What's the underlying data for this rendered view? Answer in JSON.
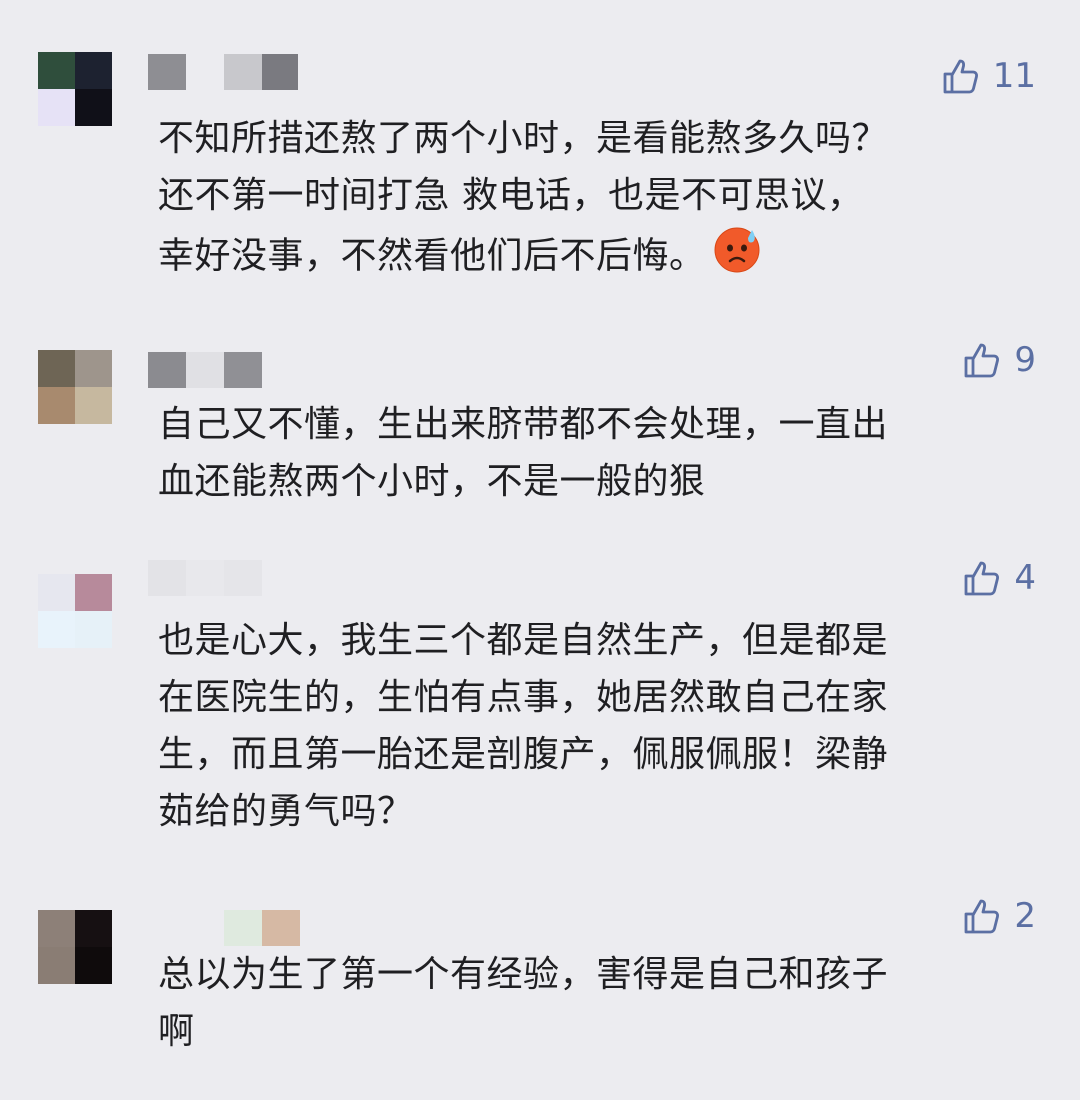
{
  "comments": [
    {
      "likes": "11",
      "lines": [
        "不知所措还熬了两个小时，是看能熬多久吗？",
        "还不第一时间打急 救电话，也是不可思议，",
        "幸好没事，不然看他们后不后悔。"
      ],
      "emoji": "sweating-face-emoji",
      "avatar_colors": [
        "#2f4e3c",
        "#1d2230",
        "#e6e2f6",
        "#101018"
      ],
      "name_colors": [
        "#8e8e93",
        "#ececf0",
        "#c8c8cc",
        "#7a7a80"
      ]
    },
    {
      "likes": "9",
      "lines": [
        "自己又不懂，生出来脐带都不会处理，一直出",
        "血还能熬两个小时，不是一般的狠"
      ],
      "avatar_colors": [
        "#6e6555",
        "#9e958c",
        "#a88a6e",
        "#c6b89f"
      ],
      "name_colors": [
        "#8b8b90",
        "#e0e0e4",
        "#909095"
      ]
    },
    {
      "likes": "4",
      "lines": [
        "也是心大，我生三个都是自然生产，但是都是",
        "在医院生的，生怕有点事，她居然敢自己在家",
        "生，而且第一胎还是剖腹产，佩服佩服！梁静",
        "茹给的勇气吗？"
      ],
      "avatar_colors": [
        "#e6e7ef",
        "#b78a9b",
        "#e8f3fb",
        "#e6f1f8"
      ],
      "name_colors": [
        "#e3e3e7",
        "#e8e8ec",
        "#e5e5e9"
      ]
    },
    {
      "likes": "2",
      "lines": [
        "总以为生了第一个有经验，害得是自己和孩子",
        "啊"
      ],
      "avatar_colors": [
        "#8d8078",
        "#161012",
        "#8a7d74",
        "#0f0b0c"
      ],
      "name_colors": [
        "#ececf0",
        "#dfeadf",
        "#d6b9a4"
      ]
    }
  ],
  "colors": {
    "background": "#ececf0",
    "like": "#5b6fa3",
    "text": "#1f1f22"
  },
  "icons": {
    "like": "thumbs-up-icon"
  }
}
